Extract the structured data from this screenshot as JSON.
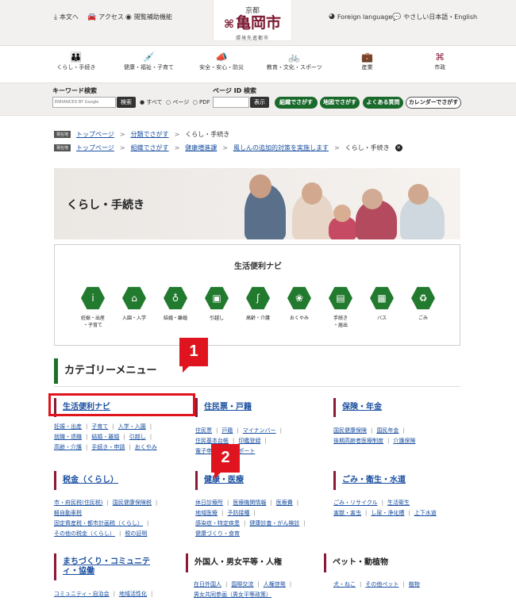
{
  "header": {
    "util_left": [
      {
        "icon": "download-icon",
        "label": "本文へ"
      },
      {
        "icon": "car-icon",
        "label": "アクセス"
      },
      {
        "icon": "eye-icon",
        "label": "閲覧補助機能"
      }
    ],
    "logo": {
      "pref": "京都",
      "city": "亀岡市",
      "tagline": "環境先進都市"
    },
    "util_right": [
      {
        "icon": "globe-icon",
        "label": "Foreign language"
      },
      {
        "icon": "speech-bubble-icon",
        "label": "やさしい日本語・English"
      }
    ]
  },
  "nav": [
    {
      "icon": "family-icon",
      "label": "くらし・手続き"
    },
    {
      "icon": "medical-icon",
      "label": "健康・福祉・子育て"
    },
    {
      "icon": "megaphone-icon",
      "label": "安全・安心・防災"
    },
    {
      "icon": "bicycle-icon",
      "label": "教育・文化・スポーツ"
    },
    {
      "icon": "briefcase-icon",
      "label": "産業"
    },
    {
      "icon": "city-emblem-icon",
      "label": "市政"
    }
  ],
  "search": {
    "keyword_label": "キーワード検索",
    "google_placeholder": "ENHANCED BY Google",
    "search_button": "検索",
    "radio_all": "すべて",
    "radio_page": "ページ",
    "radio_pdf": "PDF",
    "pageid_label": "ページ ID 検索",
    "display_button": "表示",
    "btn_org": "組織でさがす",
    "btn_map": "地図でさがす",
    "btn_faq": "よくある質問",
    "btn_calendar": "カレンダーでさがす"
  },
  "breadcrumbs": [
    {
      "badge": "現在地",
      "items": [
        "トップページ",
        "分類でさがす",
        "くらし・手続き"
      ]
    },
    {
      "badge": "現在地",
      "items": [
        "トップページ",
        "組織でさがす",
        "健康増進課",
        "風しんの追加的対策を実施します",
        "くらし・手続き"
      ]
    }
  ],
  "hero": {
    "title": "くらし・手続き"
  },
  "navi": {
    "title": "生活便利ナビ",
    "items": [
      {
        "icon": "pregnancy-icon",
        "label": "妊娠・出産\n・子育て"
      },
      {
        "icon": "school-icon",
        "label": "入園・入学"
      },
      {
        "icon": "wedding-icon",
        "label": "結婚・離婚"
      },
      {
        "icon": "moving-truck-icon",
        "label": "引越し"
      },
      {
        "icon": "elderly-icon",
        "label": "高齢・介護"
      },
      {
        "icon": "lotus-icon",
        "label": "おくやみ"
      },
      {
        "icon": "document-icon",
        "label": "手続き\n・届出"
      },
      {
        "icon": "bus-icon",
        "label": "バス"
      },
      {
        "icon": "garbage-icon",
        "label": "ごみ"
      }
    ]
  },
  "category": {
    "title": "カテゴリーメニュー",
    "blocks": [
      {
        "title": "生活便利ナビ",
        "rows": [
          [
            "妊娠・出産",
            "子育て",
            "入学・入園"
          ],
          [
            "就職・退職",
            "結婚・離婚",
            "引越し"
          ],
          [
            "高齢・介護",
            "手続き・申請",
            "おくやみ"
          ]
        ]
      },
      {
        "title": "住民票・戸籍",
        "rows": [
          [
            "住民票",
            "戸籍",
            "マイナンバー"
          ],
          [
            "住民基本台帳",
            "印鑑登録"
          ],
          [
            "電子申請",
            "パスポート"
          ]
        ]
      },
      {
        "title": "保険・年金",
        "rows": [
          [
            "国民健康保険",
            "国民年金"
          ],
          [
            "後期高齢者医療制度",
            "介護保険"
          ]
        ]
      },
      {
        "title": "税金（くらし）",
        "rows": [
          [
            "市・府民税(住民税)",
            "国民健康保険税"
          ],
          [
            "軽自動車税"
          ],
          [
            "固定資産税・都市計画税（くらし）"
          ],
          [
            "その他の税金（くらし）",
            "税の証明"
          ]
        ]
      },
      {
        "title": "健康・医療",
        "rows": [
          [
            "休日診療所",
            "医療機関情報",
            "医療費"
          ],
          [
            "地域医療",
            "予防接種"
          ],
          [
            "感染症・特定疾患",
            "健康診査・がん検診"
          ],
          [
            "健康づくり・食育"
          ]
        ]
      },
      {
        "title": "ごみ・衛生・水道",
        "rows": [
          [
            "ごみ・リサイクル",
            "生活衛生"
          ],
          [
            "害獣・害虫",
            "し尿・浄化槽",
            "上下水道"
          ]
        ]
      },
      {
        "title": "まちづくり・コミュニテ\nィ・協働",
        "rows": [
          [
            "コミュニティ・自治会",
            "地域活性化"
          ]
        ]
      },
      {
        "title": "外国人・男女平等・人権",
        "rows": [
          [
            "在日外国人",
            "国際交流",
            "人権啓発"
          ],
          [
            "男女共同参画（男女平等政策）"
          ]
        ]
      },
      {
        "title": "ペット・動植物",
        "rows": [
          [
            "犬・ねこ",
            "その他ペット",
            "植物"
          ]
        ]
      }
    ]
  },
  "annotations": {
    "callout1": "1",
    "callout2": "2"
  },
  "colors": {
    "accent_green": "#1f6e2c",
    "accent_maroon": "#8a1a36",
    "link_blue": "#1a4fa0",
    "annotation_red": "#e0141e"
  }
}
